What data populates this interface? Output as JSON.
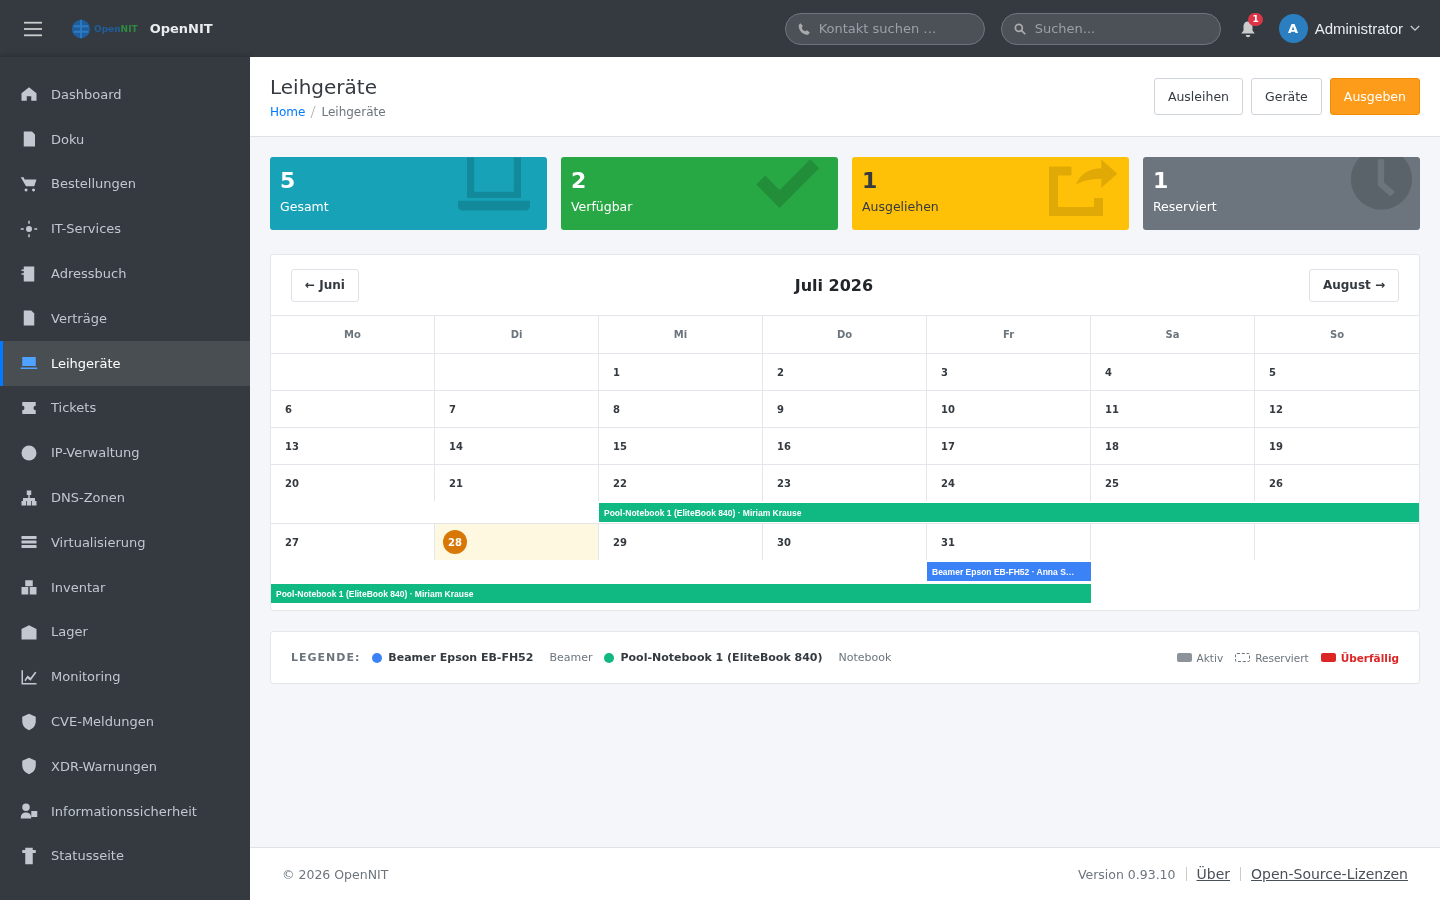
{
  "topbar": {
    "logo": {
      "part_1": "Open",
      "part_2": "NIT"
    },
    "brand": "OpenNIT",
    "contact_search": {
      "placeholder": "Kontakt suchen …"
    },
    "search": {
      "placeholder": "Suchen..."
    },
    "notifications": "1",
    "user": {
      "initial": "A",
      "name": "Administrator"
    }
  },
  "sidebar": {
    "items": [
      {
        "label": "Dashboard",
        "selected": false
      },
      {
        "label": "Doku",
        "selected": false
      },
      {
        "label": "Bestellungen",
        "selected": false
      },
      {
        "label": "IT-Services",
        "selected": false
      },
      {
        "label": "Adressbuch",
        "selected": false
      },
      {
        "label": "Verträge",
        "selected": false
      },
      {
        "label": "Leihgeräte",
        "selected": true
      },
      {
        "label": "Tickets",
        "selected": false
      },
      {
        "label": "IP-Verwaltung",
        "selected": false
      },
      {
        "label": "DNS-Zonen",
        "selected": false
      },
      {
        "label": "Virtualisierung",
        "selected": false
      },
      {
        "label": "Inventar",
        "selected": false
      },
      {
        "label": "Lager",
        "selected": false
      },
      {
        "label": "Monitoring",
        "selected": false
      },
      {
        "label": "CVE-Meldungen",
        "selected": false
      },
      {
        "label": "XDR-Warnungen",
        "selected": false
      },
      {
        "label": "Informationssicherheit",
        "selected": false
      },
      {
        "label": "Statusseite",
        "selected": false
      }
    ]
  },
  "page": {
    "title": "Leihgeräte",
    "breadcrumb": [
      {
        "label": "Home",
        "link": true
      },
      {
        "label": "Leihgeräte",
        "link": false
      }
    ],
    "buttons": [
      {
        "label": "Ausleihen",
        "primary": false
      },
      {
        "label": "Geräte",
        "primary": false
      },
      {
        "label": "Ausgeben",
        "primary": true
      }
    ]
  },
  "stats": [
    {
      "value": "5",
      "label": "Gesamt",
      "color": "#17a2b8"
    },
    {
      "value": "2",
      "label": "Verfügbar",
      "color": "#28a745"
    },
    {
      "value": "1",
      "label": "Ausgeliehen",
      "color": "#ffc107"
    },
    {
      "value": "1",
      "label": "Reserviert",
      "color": "#6c757d"
    }
  ],
  "calendar": {
    "prev": "← Juni",
    "title": "Juli 2026",
    "next": "August →",
    "weekdays": [
      "Mo",
      "Di",
      "Mi",
      "Do",
      "Fr",
      "Sa",
      "So"
    ],
    "weeks": [
      {
        "days": [
          {
            "kind": "empty"
          },
          {
            "kind": "empty"
          },
          {
            "kind": "day",
            "label": "1",
            "today": false
          },
          {
            "kind": "day",
            "label": "2",
            "today": false
          },
          {
            "kind": "day",
            "label": "3",
            "today": false
          },
          {
            "kind": "day",
            "label": "4",
            "today": false
          },
          {
            "kind": "day",
            "label": "5",
            "today": false
          }
        ]
      },
      {
        "days": [
          {
            "kind": "day",
            "label": "6",
            "today": false
          },
          {
            "kind": "day",
            "label": "7",
            "today": false
          },
          {
            "kind": "day",
            "label": "8",
            "today": false
          },
          {
            "kind": "day",
            "label": "9",
            "today": false
          },
          {
            "kind": "day",
            "label": "10",
            "today": false
          },
          {
            "kind": "day",
            "label": "11",
            "today": false
          },
          {
            "kind": "day",
            "label": "12",
            "today": false
          }
        ]
      },
      {
        "days": [
          {
            "kind": "day",
            "label": "13",
            "today": false
          },
          {
            "kind": "day",
            "label": "14",
            "today": false
          },
          {
            "kind": "day",
            "label": "15",
            "today": false
          },
          {
            "kind": "day",
            "label": "16",
            "today": false
          },
          {
            "kind": "day",
            "label": "17",
            "today": false
          },
          {
            "kind": "day",
            "label": "18",
            "today": false
          },
          {
            "kind": "day",
            "label": "19",
            "today": false
          }
        ]
      },
      {
        "days": [
          {
            "kind": "day",
            "label": "20",
            "today": false
          },
          {
            "kind": "day",
            "label": "21",
            "today": false
          },
          {
            "kind": "day",
            "label": "22",
            "today": false
          },
          {
            "kind": "day",
            "label": "23",
            "today": false
          },
          {
            "kind": "day",
            "label": "24",
            "today": false
          },
          {
            "kind": "day",
            "label": "25",
            "today": false
          },
          {
            "kind": "day",
            "label": "26",
            "today": false
          }
        ],
        "events": [
          {
            "label": "Pool-Notebook 1 (EliteBook 840) · Miriam Krause",
            "color": "#10b981"
          }
        ]
      },
      {
        "days": [
          {
            "kind": "day",
            "label": "27",
            "today": false
          },
          {
            "kind": "day",
            "label": "28",
            "today": true
          },
          {
            "kind": "day",
            "label": "29",
            "today": false
          },
          {
            "kind": "day",
            "label": "30",
            "today": false
          },
          {
            "kind": "day",
            "label": "31",
            "today": false
          },
          {
            "kind": "empty"
          },
          {
            "kind": "empty"
          }
        ],
        "events": [
          {
            "label": "Beamer Epson EB-FH52 · Anna S…",
            "color": "#3b82f6"
          },
          {
            "label": "Pool-Notebook 1 (EliteBook 840) · Miriam Krause",
            "color": "#10b981"
          }
        ]
      }
    ]
  },
  "legend": {
    "title": "LEGENDE:",
    "devices": [
      {
        "name": "Beamer Epson EB-FH52",
        "type": "Beamer",
        "color": "#3b82f6"
      },
      {
        "name": "Pool-Notebook 1 (EliteBook 840)",
        "type": "Notebook",
        "color": "#10b981"
      }
    ],
    "states": [
      {
        "kind": "active",
        "label": "Aktiv"
      },
      {
        "kind": "reserved",
        "label": "Reserviert"
      },
      {
        "kind": "overdue",
        "label": "Überfällig"
      }
    ]
  },
  "footer": {
    "copyright": "© 2026 OpenNIT",
    "version": "Version 0.93.10",
    "links": [
      "Über",
      "Open-Source-Lizenzen"
    ]
  }
}
